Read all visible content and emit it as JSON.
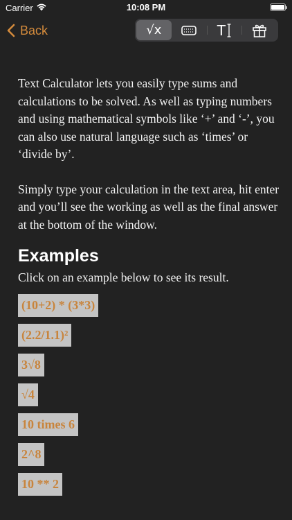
{
  "status_bar": {
    "carrier": "Carrier",
    "time": "10:08 PM"
  },
  "nav": {
    "back_label": "Back",
    "segments": [
      {
        "icon": "sqrt-x-icon",
        "label": "√x",
        "selected": true
      },
      {
        "icon": "keyboard-icon",
        "label": "",
        "selected": false
      },
      {
        "icon": "text-cursor-icon",
        "label": "T",
        "selected": false
      },
      {
        "icon": "gift-icon",
        "label": "",
        "selected": false
      }
    ]
  },
  "content": {
    "intro": "Text Calculator lets you easily type sums and calculations to be solved. As well as typing numbers and using mathematical symbols like ‘+’ and ‘-’, you can also use natural language such as ‘times’ or ‘divide by’.",
    "instructions": "Simply type your calculation in the text area, hit enter and you’ll see the working as well as the final answer at the bottom of the window.",
    "examples_heading": "Examples",
    "examples_subtitle": "Click on an example below to see its result.",
    "examples": [
      "(10+2) * (3*3)",
      "(2.2/1.1)²",
      "3√8",
      "√4",
      "10 times 6",
      "2^8",
      "10 ** 2"
    ]
  },
  "colors": {
    "accent": "#d48b3c",
    "background": "#222222",
    "chip": "#c4c4c4"
  }
}
